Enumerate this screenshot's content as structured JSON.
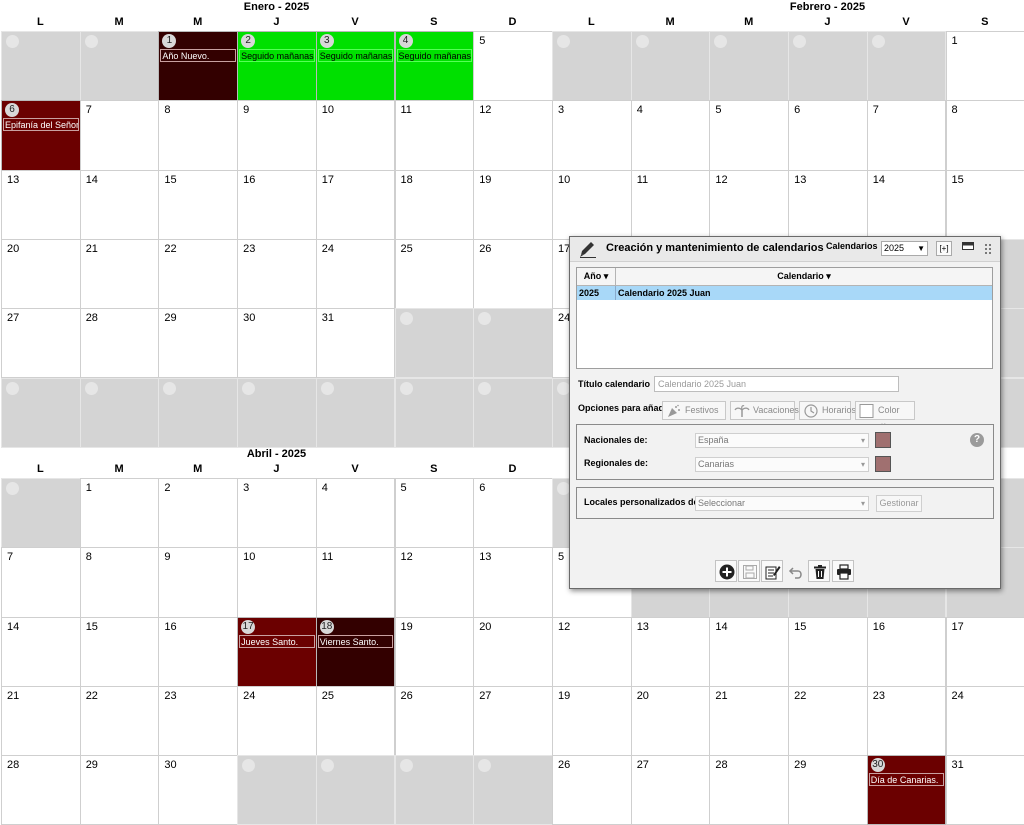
{
  "weekdays": [
    "L",
    "M",
    "M",
    "J",
    "V",
    "S",
    "D"
  ],
  "months": {
    "enero": {
      "title": "Enero - 2025",
      "weeks": [
        [
          "",
          "",
          "1",
          "2",
          "3",
          "4",
          "5"
        ],
        [
          "6",
          "7",
          "8",
          "9",
          "10",
          "11",
          "12"
        ],
        [
          "13",
          "14",
          "15",
          "16",
          "17",
          "18",
          "19"
        ],
        [
          "20",
          "21",
          "22",
          "23",
          "24",
          "25",
          "26"
        ],
        [
          "27",
          "28",
          "29",
          "30",
          "31",
          "",
          ""
        ],
        [
          "",
          "",
          "",
          "",
          "",
          "",
          ""
        ]
      ],
      "events": {
        "1": {
          "label": "Año Nuevo.",
          "color": "vdred"
        },
        "2": {
          "label": "Seguido mañanas de",
          "color": "green"
        },
        "3": {
          "label": "Seguido mañanas de",
          "color": "green"
        },
        "4": {
          "label": "Seguido mañanas de",
          "color": "green"
        },
        "6": {
          "label": "Epifanía del Señor.",
          "color": "dkred"
        }
      }
    },
    "febrero": {
      "title": "Febrero - 2025",
      "weeks": [
        [
          "",
          "",
          "",
          "",
          "",
          "1"
        ],
        [
          "3",
          "4",
          "5",
          "6",
          "7",
          "8"
        ],
        [
          "10",
          "11",
          "12",
          "13",
          "14",
          "15"
        ],
        [
          "17",
          "",
          "",
          "",
          "",
          ""
        ],
        [
          "24",
          "",
          "",
          "",
          "",
          ""
        ],
        [
          "",
          "",
          "",
          "",
          "",
          ""
        ]
      ],
      "events": {}
    },
    "abril": {
      "title": "Abril - 2025",
      "weeks": [
        [
          "",
          "1",
          "2",
          "3",
          "4",
          "5",
          "6"
        ],
        [
          "7",
          "8",
          "9",
          "10",
          "11",
          "12",
          "13"
        ],
        [
          "14",
          "15",
          "16",
          "17",
          "18",
          "19",
          "20"
        ],
        [
          "21",
          "22",
          "23",
          "24",
          "25",
          "26",
          "27"
        ],
        [
          "28",
          "29",
          "30",
          "",
          "",
          "",
          ""
        ]
      ],
      "events": {
        "17": {
          "label": "Jueves Santo.",
          "color": "dkred"
        },
        "18": {
          "label": "Viernes Santo.",
          "color": "vdred"
        }
      }
    },
    "mayo": {
      "weeks": [
        [
          "",
          "",
          "",
          "",
          "",
          ""
        ],
        [
          "5",
          "",
          "",
          "",
          "",
          ""
        ],
        [
          "12",
          "13",
          "14",
          "15",
          "16",
          "17"
        ],
        [
          "19",
          "20",
          "21",
          "22",
          "23",
          "24"
        ],
        [
          "26",
          "27",
          "28",
          "29",
          "30",
          "31"
        ]
      ],
      "events": {
        "30": {
          "label": "Día de Canarias.",
          "color": "dkred"
        }
      }
    }
  },
  "colors": {
    "green": "#00e000",
    "dkred": "#6b0000",
    "vdred": "#330000",
    "swatch": "#a07070",
    "row_selected": "#a8d8f8"
  },
  "dialog": {
    "title": "Creación y mantenimiento de calendarios",
    "calendarios_label": "Calendarios",
    "year_value": "2025",
    "plus_label": "[+]",
    "table": {
      "col_year": "Año",
      "col_calendar": "Calendario",
      "rows": [
        {
          "year": "2025",
          "calendar": "Calendario 2025 Juan"
        }
      ]
    },
    "titulo_label": "Título calendario",
    "titulo_value": "Calendario 2025 Juan",
    "opciones_label": "Opciones para añadir",
    "options": {
      "festivos": "Festivos",
      "vacaciones": "Vacaciones",
      "horarios": "Horarios",
      "color": "Color días"
    },
    "nacionales_label": "Nacionales de:",
    "nacionales_value": "España",
    "regionales_label": "Regionales de:",
    "regionales_value": "Canarias",
    "locales_label": "Locales personalizados de",
    "locales_value": "Seleccionar",
    "gestionar_label": "Gestionar",
    "help": "?"
  }
}
